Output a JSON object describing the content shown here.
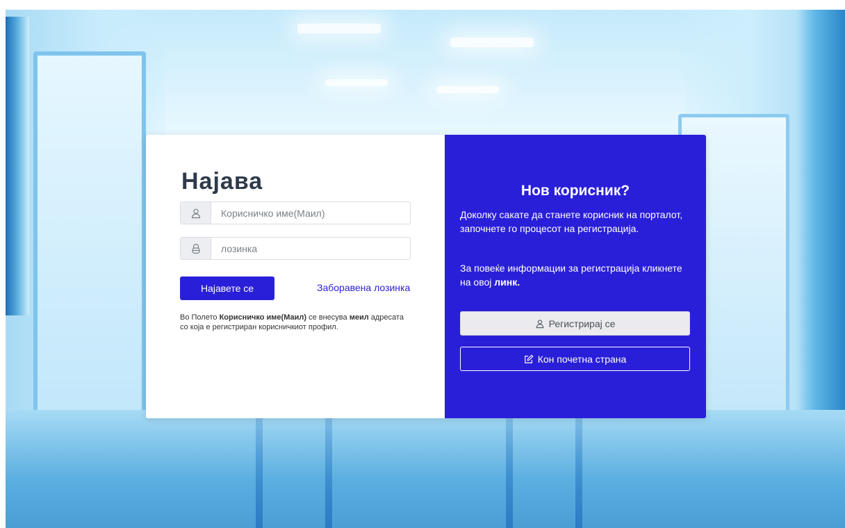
{
  "login": {
    "title": "Најава",
    "username_placeholder": "Корисничко име(Маил)",
    "password_placeholder": "лозинка",
    "submit_label": "Најавете се",
    "forgot_password_label": "Заборавена лозинка",
    "hint": {
      "part1": "Во Полето ",
      "bold1": "Корисничко име(Маил)",
      "part2": " се внесува ",
      "bold2": "меил",
      "part3": " адресата со која е регистриран корисничкиот профил."
    }
  },
  "new_user": {
    "title": "Нов корисник?",
    "description": "Доколку сакате да станете корисник на порталот, започнете го процесот на регистрација.",
    "more_info_text": "За повеќе информации за регистрација кликнете на овој ",
    "more_info_link": "линк.",
    "register_label": "Регистрирај се",
    "home_label": "Кон почетна страна"
  },
  "colors": {
    "accent": "#2a1fd9",
    "title_text": "#2f3a4b",
    "register_button_bg": "#ebebef"
  },
  "icons": {
    "username": "user-icon",
    "password": "lock-icon",
    "register": "user-icon",
    "home": "edit-icon"
  }
}
